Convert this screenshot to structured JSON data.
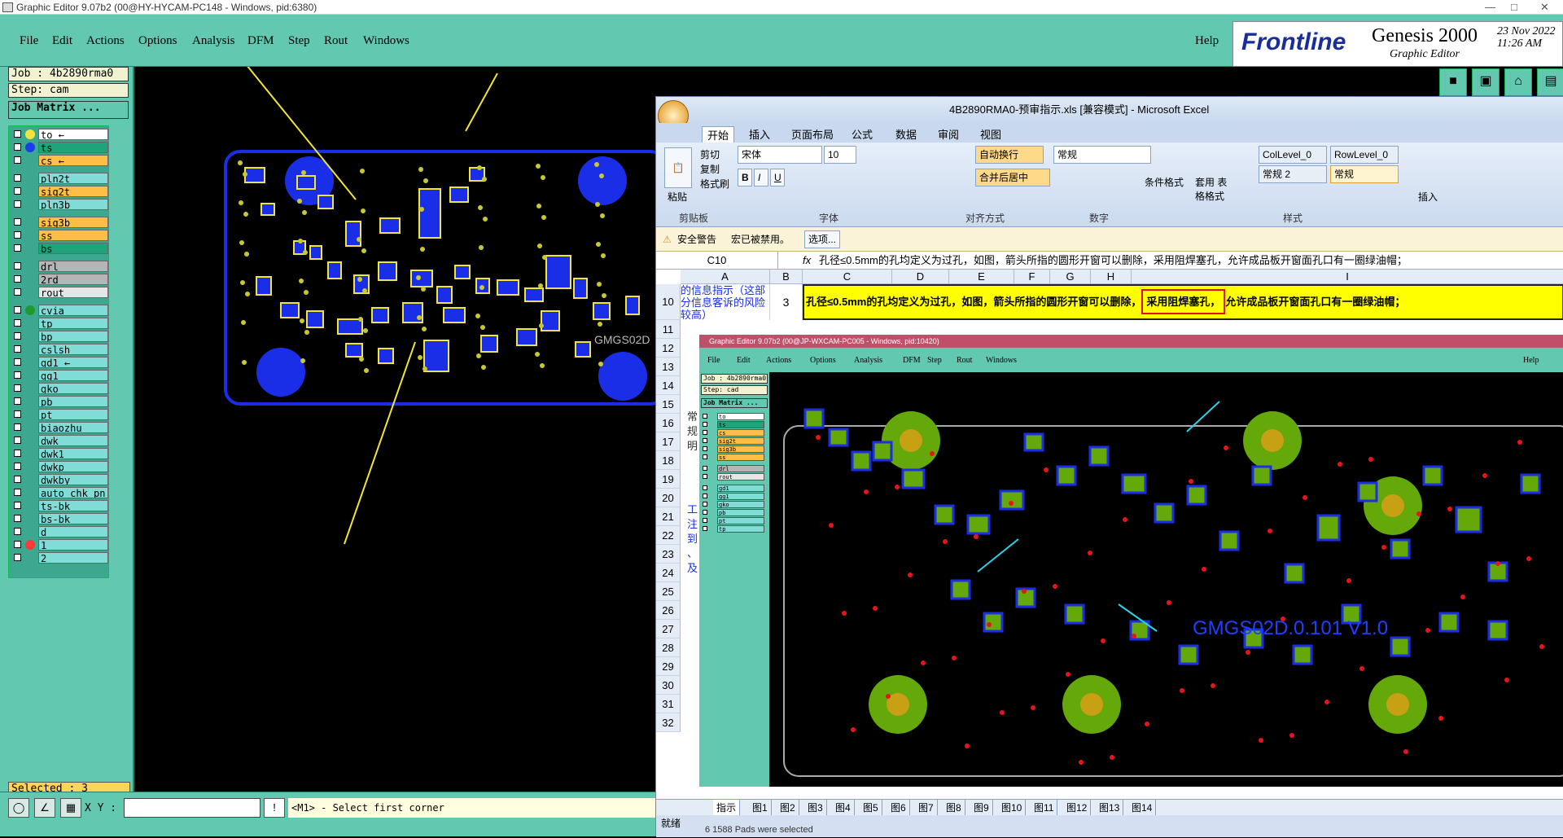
{
  "window": {
    "title": "Graphic Editor 9.07b2 (00@HY-HYCAM-PC148 - Windows, pid:6380)"
  },
  "menu": [
    "File",
    "Edit",
    "Actions",
    "Options",
    "Analysis",
    "DFM",
    "Step",
    "Rout",
    "Windows"
  ],
  "help": "Help",
  "brand": {
    "logo": "Frontline",
    "product": "Genesis 2000",
    "subtitle": "Graphic Editor",
    "date": "23 Nov 2022",
    "time": "11:26 AM"
  },
  "job": {
    "job": "Job : 4b2890rma0",
    "step": "Step: cam",
    "matrix": "Job Matrix ..."
  },
  "layers": [
    {
      "name": "to",
      "dot": "#f2e43a",
      "bg": "#ffffff",
      "mark": "←"
    },
    {
      "name": "ts",
      "dot": "#1a3ee8",
      "bg": "#1ea37a",
      "mark": ""
    },
    {
      "name": "cs",
      "dot": "",
      "bg": "#ffbe45",
      "mark": "←"
    },
    {
      "gap": true
    },
    {
      "name": "pln2t",
      "bg": "#7fdcd6"
    },
    {
      "name": "sig2t",
      "bg": "#ffbe45"
    },
    {
      "name": "pln3b",
      "bg": "#7fdcd6"
    },
    {
      "gap": true
    },
    {
      "name": "sig3b",
      "bg": "#ffbe45"
    },
    {
      "name": "ss",
      "bg": "#ffbe45"
    },
    {
      "name": "bs",
      "bg": "#1ea37a"
    },
    {
      "gap": true
    },
    {
      "name": "drl",
      "bg": "#b5b5b5"
    },
    {
      "name": "2rd",
      "bg": "#b5b5b5"
    },
    {
      "name": "rout",
      "bg": "#e6e6e6"
    },
    {
      "gap": true
    },
    {
      "name": "cvia",
      "dot": "#1e9a2e",
      "bg": "#7fdcd6"
    },
    {
      "name": "tp",
      "bg": "#7fdcd6"
    },
    {
      "name": "bp",
      "bg": "#7fdcd6"
    },
    {
      "name": "cslsh",
      "bg": "#7fdcd6"
    },
    {
      "name": "gd1",
      "bg": "#7fdcd6",
      "mark": "←"
    },
    {
      "name": "gg1",
      "bg": "#7fdcd6"
    },
    {
      "name": "gko",
      "bg": "#7fdcd6"
    },
    {
      "name": "pb",
      "bg": "#7fdcd6"
    },
    {
      "name": "pt",
      "bg": "#7fdcd6"
    },
    {
      "name": "biaozhu",
      "bg": "#7fdcd6"
    },
    {
      "name": "dwk",
      "bg": "#7fdcd6"
    },
    {
      "name": "dwk1",
      "bg": "#7fdcd6"
    },
    {
      "name": "dwkp",
      "bg": "#7fdcd6"
    },
    {
      "name": "dwkby",
      "bg": "#7fdcd6"
    },
    {
      "name": "auto_chk_pn",
      "bg": "#7fdcd6"
    },
    {
      "name": "ts-bk",
      "bg": "#7fdcd6"
    },
    {
      "name": "bs-bk",
      "bg": "#7fdcd6"
    },
    {
      "name": "d",
      "bg": "#7fdcd6"
    },
    {
      "name": "1",
      "dot": "#ff3a3a",
      "bg": "#7fdcd6"
    },
    {
      "name": "2",
      "bg": "#7fdcd6"
    }
  ],
  "selected": "Selected : 3",
  "bottom": {
    "xy_label": "X Y :",
    "xy_value": "",
    "prompt": "<M1> - Select first corner",
    "status_tail": "6 1588 Pads were selected"
  },
  "board_text": "GMGS02D",
  "excel": {
    "title": "4B2890RMA0-预审指示.xls  [兼容模式] - Microsoft Excel",
    "tabs": [
      "开始",
      "插入",
      "页面布局",
      "公式",
      "数据",
      "审阅",
      "视图"
    ],
    "clipboard": {
      "cut": "剪切",
      "copy": "复制",
      "paste": "粘贴",
      "painter": "格式刷",
      "label": "剪贴板"
    },
    "font": {
      "name": "宋体",
      "size": "10",
      "label": "字体"
    },
    "align": {
      "wrap": "自动换行",
      "merge": "合并后居中",
      "label": "对齐方式"
    },
    "number": {
      "format": "常规",
      "label": "数字"
    },
    "styles": {
      "cond": "条件格式",
      "table": "套用\n表格格式",
      "col": "ColLevel_0",
      "row": "RowLevel_0",
      "normal2": "常规 2",
      "normal": "常规",
      "label": "样式",
      "insert": "插入"
    },
    "security": {
      "title": "安全警告",
      "msg": "宏已被禁用。",
      "options": "选项..."
    },
    "cellref": "C10",
    "formula": "孔径≤0.5mm的孔均定义为过孔，如图，箭头所指的圆形开窗可以删除，采用阻焊塞孔，允许成品板开窗面孔口有一圈绿油帽；",
    "columns": [
      "A",
      "B",
      "C",
      "D",
      "E",
      "F",
      "G",
      "H",
      "I"
    ],
    "rows": [
      "10",
      "11",
      "12",
      "13",
      "14",
      "15",
      "16",
      "17",
      "18",
      "19",
      "20",
      "21",
      "22",
      "23",
      "24",
      "25",
      "26",
      "27",
      "28",
      "29",
      "30",
      "31",
      "32"
    ],
    "a_text": "的信息指示（这部分信息客诉的风险较高）",
    "b10": "3",
    "c10": "孔径≤0.5mm的孔均定义为过孔，如图，箭头所指的圆形开窗可以删除，",
    "h10": "采用阻焊塞孔，",
    "i10": "允许成品板开窗面孔口有一圈绿油帽；",
    "side_a": [
      "常",
      "规",
      "明",
      "工",
      "注",
      "到",
      "、",
      "及"
    ],
    "sheets": [
      "指示",
      "图1",
      "图2",
      "图3",
      "图4",
      "图5",
      "图6",
      "图7",
      "图8",
      "图9",
      "图10",
      "图11",
      "图12",
      "图13",
      "图14"
    ],
    "status": "就绪"
  },
  "inner": {
    "title": "Graphic Editor 9.07b2 (00@JP-WXCAM-PC005 - Windows, pid:10420)",
    "menu": [
      "File",
      "Edit",
      "Actions",
      "Options",
      "Analysis",
      "DFM",
      "Step",
      "Rout",
      "Windows"
    ],
    "help": "Help",
    "job": "Job : 4b2890rma0",
    "step": "Step: cad",
    "matrix": "Job Matrix ...",
    "layers": [
      "to",
      "ts",
      "cs",
      "sig2t",
      "sig3b",
      "ss",
      "drl",
      "rout",
      "gd1",
      "gg1",
      "gko",
      "pb",
      "pt",
      "tp"
    ],
    "board_text": "GMGS02D.0.101  V1.0"
  }
}
